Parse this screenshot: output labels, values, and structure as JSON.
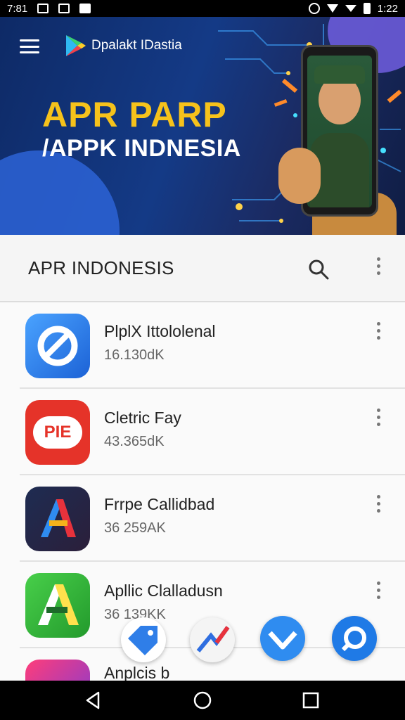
{
  "status_bar": {
    "left_text": "7:81",
    "time": "1:22"
  },
  "banner": {
    "brand_name": "Dpalakt IDastia",
    "headline_line1": "APR PARP",
    "headline_line2": "/APPK INDNESIA"
  },
  "app_bar": {
    "title": "APR INDONESIS"
  },
  "apps": [
    {
      "name": "PlplX Ittololenal",
      "size": "16.130dK",
      "icon": "blue-loop-app-icon",
      "color": "#2f7ee8"
    },
    {
      "name": "Cletric Fay",
      "size": "43.365dK",
      "icon": "pie-app-icon",
      "color": "#e53329",
      "icon_text": "PIE"
    },
    {
      "name": "Frrpe Callidbad",
      "size": "36 259AK",
      "icon": "letter-a-app-icon",
      "color": "#1f2a4a"
    },
    {
      "name": "Apllic Clalladusn",
      "size": "36 139KK",
      "icon": "green-a-app-icon",
      "color": "#35b93c"
    },
    {
      "name": "Anplcis b",
      "size": "",
      "icon": "pink-app-icon",
      "color": "#e8245a"
    }
  ],
  "floating_icons": [
    "tag-icon",
    "share-arrow-icon",
    "check-chevron-icon",
    "search-ring-icon"
  ],
  "nav": {
    "icons": [
      "back-icon",
      "home-icon",
      "recents-icon"
    ]
  }
}
